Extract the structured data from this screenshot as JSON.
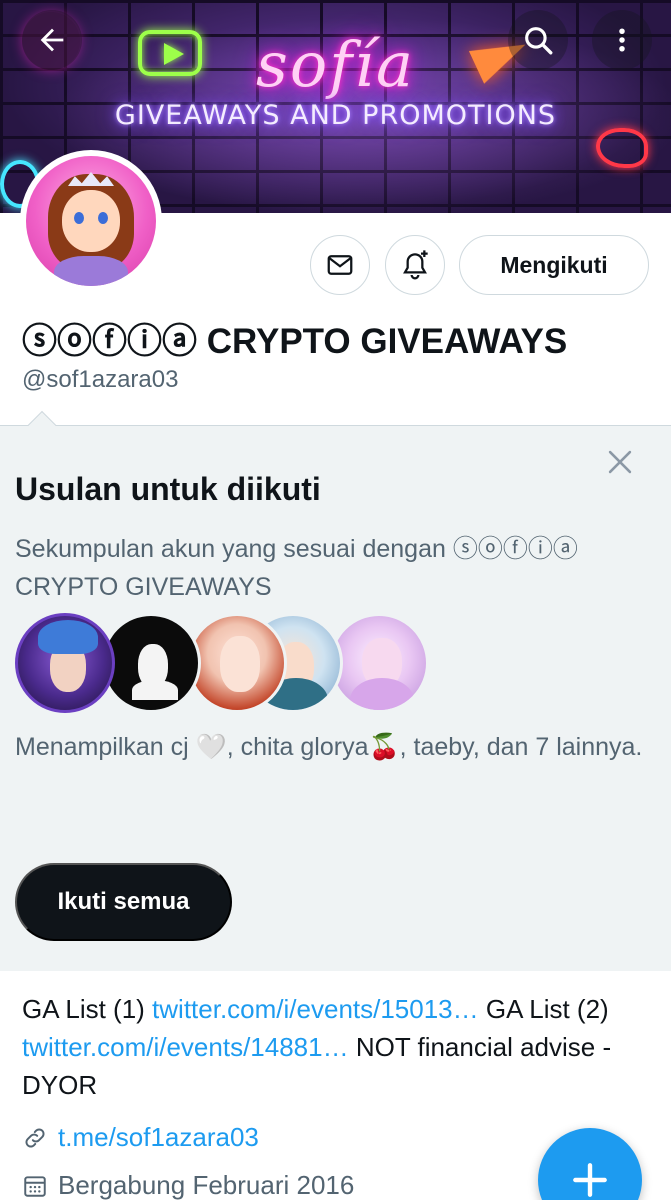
{
  "banner": {
    "title": "sofía",
    "subtitle": "GIVEAWAYS AND PROMOTIONS"
  },
  "header": {
    "back_icon": "arrow-left-icon",
    "search_icon": "search-icon",
    "more_icon": "more-vertical-icon"
  },
  "profile": {
    "display_name": "ⓢⓞⓕⓘⓐ CRYPTO GIVEAWAYS",
    "handle": "@sof1azara03",
    "follow_label": "Mengikuti",
    "message_icon": "mail-icon",
    "notify_icon": "bell-plus-icon"
  },
  "suggestions": {
    "title": "Usulan untuk diikuti",
    "description": "Sekumpulan akun yang sesuai dengan ⓢⓞⓕⓘⓐ CRYPTO GIVEAWAYS",
    "showing": "Menampilkan cj 🤍, chita glorya🍒, taeby, dan 7 lainnya.",
    "follow_all_label": "Ikuti semua",
    "close_icon": "close-icon"
  },
  "bio": {
    "part1": "GA List (1) ",
    "link1": "twitter.com/i/events/15013…",
    "part2": " GA List (2) ",
    "link2": "twitter.com/i/events/14881…",
    "part3": "  NOT financial advise - DYOR"
  },
  "meta": {
    "website": "t.me/sof1azara03",
    "joined": "Bergabung Februari 2016"
  },
  "fab": {
    "icon": "plus-icon"
  },
  "colors": {
    "accent": "#1d9bf0",
    "text_primary": "#0f1419",
    "text_secondary": "#536471",
    "card_bg": "#eff3f4"
  }
}
